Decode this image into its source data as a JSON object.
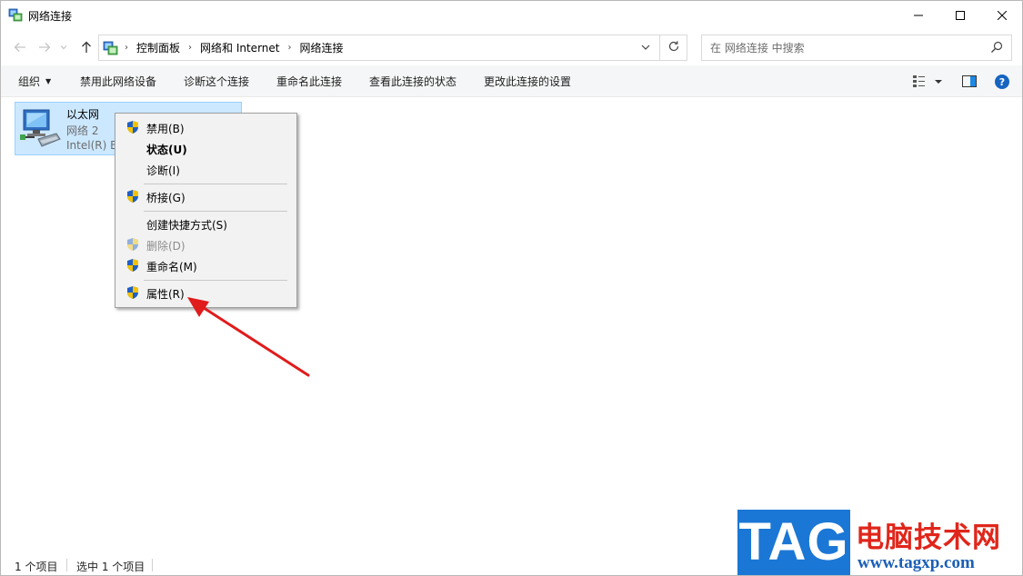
{
  "window": {
    "title": "网络连接",
    "minimize_icon": "minimize-icon",
    "maximize_icon": "maximize-icon",
    "close_icon": "close-icon"
  },
  "nav": {
    "back_icon": "arrow-left-icon",
    "forward_icon": "arrow-right-icon",
    "recent_icon": "chevron-down-icon",
    "up_icon": "arrow-up-icon",
    "breadcrumbs": [
      "控制面板",
      "网络和 Internet",
      "网络连接"
    ],
    "refresh_icon": "refresh-icon"
  },
  "search": {
    "placeholder": "在 网络连接 中搜索"
  },
  "toolbar": {
    "organize": "组织",
    "disable": "禁用此网络设备",
    "diagnose": "诊断这个连接",
    "rename": "重命名此连接",
    "view_status": "查看此连接的状态",
    "change_settings": "更改此连接的设置"
  },
  "connection": {
    "name": "以太网",
    "network": "网络 2",
    "adapter": "Intel(R) E"
  },
  "context_menu": {
    "disable": "禁用(B)",
    "status": "状态(U)",
    "diagnose": "诊断(I)",
    "bridge": "桥接(G)",
    "create_shortcut": "创建快捷方式(S)",
    "delete": "删除(D)",
    "rename": "重命名(M)",
    "properties": "属性(R)"
  },
  "statusbar": {
    "items": "1 个项目",
    "selected": "选中 1 个项目"
  },
  "watermark": {
    "tag": "TAG",
    "chinese": "电脑技术网",
    "url": "www.tagxp.com"
  },
  "colors": {
    "accent": "#0078d7",
    "selection": "#cce8ff",
    "arrow": "#e01c1c"
  }
}
